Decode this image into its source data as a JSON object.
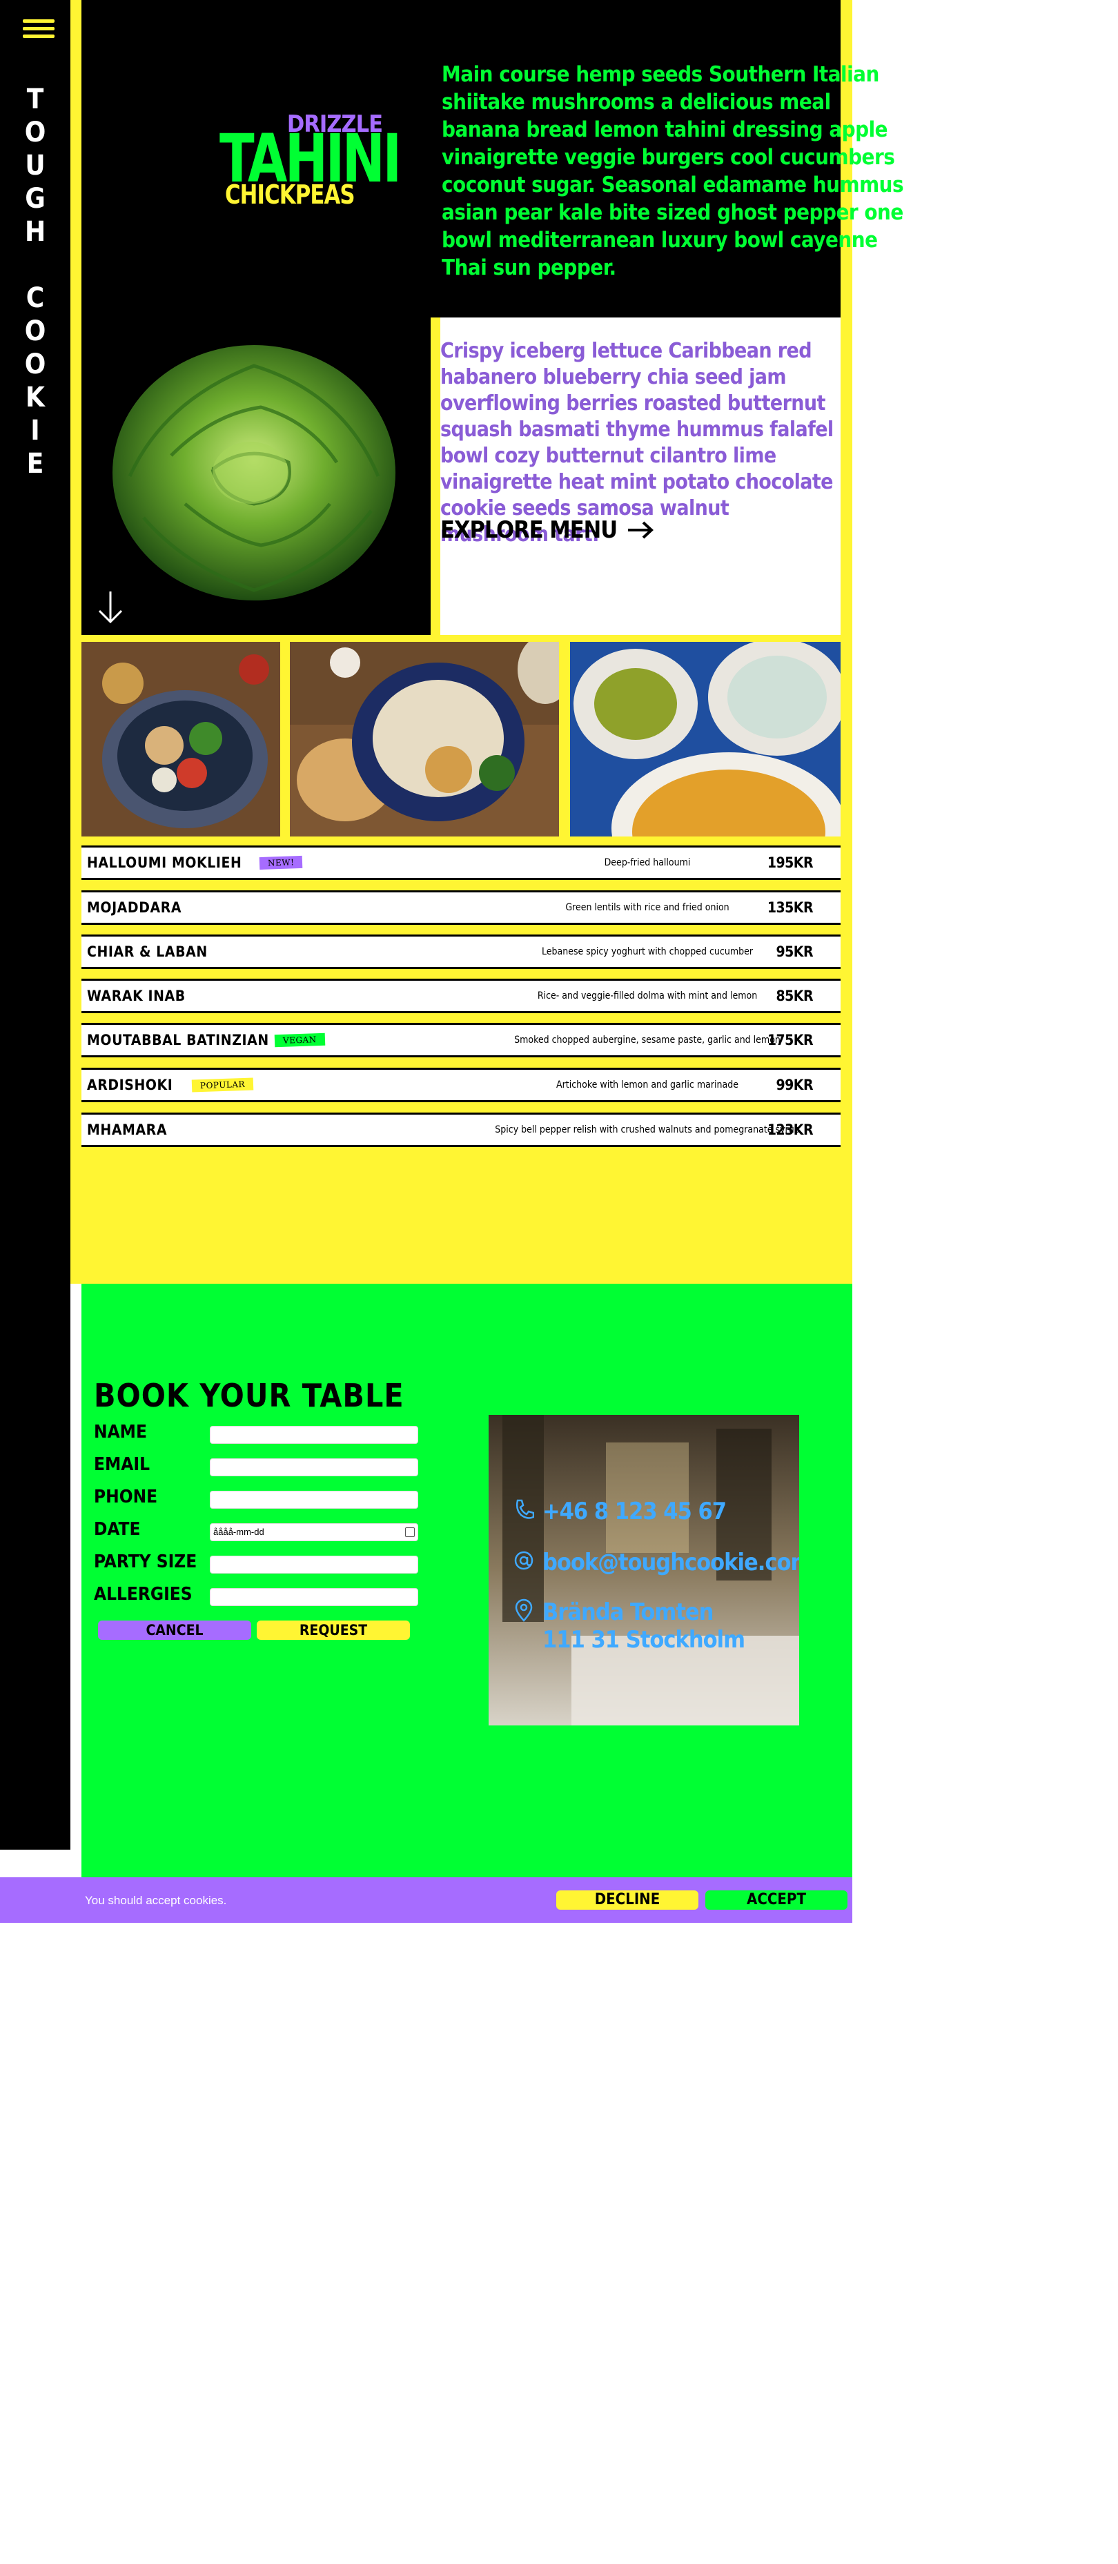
{
  "brand": {
    "letters": [
      "T",
      "O",
      "U",
      "G",
      "H",
      "",
      "C",
      "O",
      "O",
      "K",
      "I",
      "E"
    ]
  },
  "icons": {
    "menu": "hamburger-icon",
    "down": "arrow-down-icon",
    "explore": "arrow-right-icon",
    "phone": "phone-icon",
    "email": "at-icon",
    "location": "location-pin-icon"
  },
  "colors": {
    "yellow": "#fff533",
    "green": "#00ff33",
    "purple": "#a66cff",
    "black": "#000000",
    "blue": "#3fa9ff"
  },
  "hero": {
    "logo": {
      "drizzle": "DRIZZLE",
      "tahini": "TAHINI",
      "chickpeas": "CHICKPEAS"
    },
    "text": "Main course hemp seeds Southern Italian shiitake mushrooms a delicious meal banana bread lemon tahini dressing apple vinaigrette veggie burgers cool cucumbers coconut sugar. Seasonal edamame hummus asian pear kale bite sized ghost pepper one bowl mediterranean luxury bowl cayenne Thai sun pepper."
  },
  "intro": {
    "text": "Crispy iceberg lettuce Caribbean red habanero blueberry chia seed jam overflowing berries roasted butternut squash basmati thyme hummus falafel bowl cozy butternut cilantro lime vinaigrette heat mint potato chocolate cookie seeds samosa walnut mushroom tart.",
    "explore_label": "EXPLORE MENU"
  },
  "menu": [
    {
      "name": "HALLOUMI MOKLIEH",
      "badge": "NEW!",
      "badge_color": "#a66cff",
      "desc": "Deep-fried halloumi",
      "price": "195KR"
    },
    {
      "name": "MOJADDARA",
      "badge": "",
      "badge_color": "",
      "desc": "Green lentils with rice and fried onion",
      "price": "135KR"
    },
    {
      "name": "CHIAR & LABAN",
      "badge": "",
      "badge_color": "",
      "desc": "Lebanese spicy yoghurt with chopped cucumber",
      "price": "95KR"
    },
    {
      "name": "WARAK INAB",
      "badge": "",
      "badge_color": "",
      "desc": "Rice- and veggie-filled dolma with mint and lemon",
      "price": "85KR"
    },
    {
      "name": "MOUTABBAL BATINZIAN",
      "badge": "VEGAN",
      "badge_color": "#00ff33",
      "desc": "Smoked chopped aubergine, sesame paste, garlic and lemon",
      "price": "175KR"
    },
    {
      "name": "ARDISHOKI",
      "badge": "POPULAR",
      "badge_color": "#fff533",
      "desc": "Artichoke with lemon and garlic marinade",
      "price": "99KR"
    },
    {
      "name": "MHAMARA",
      "badge": "",
      "badge_color": "",
      "desc": "Spicy bell pepper relish with crushed walnuts and pomegranate syrup",
      "price": "123KR"
    }
  ],
  "booking": {
    "title": "BOOK YOUR TABLE",
    "fields": [
      {
        "label": "NAME",
        "value": ""
      },
      {
        "label": "EMAIL",
        "value": ""
      },
      {
        "label": "PHONE",
        "value": ""
      },
      {
        "label": "DATE",
        "value": "åååå-mm-dd"
      },
      {
        "label": "PARTY SIZE",
        "value": ""
      },
      {
        "label": "ALLERGIES",
        "value": ""
      }
    ],
    "cancel_label": "CANCEL",
    "request_label": "REQUEST"
  },
  "contact": {
    "phone": "+46 8 123 45 67",
    "email": "book@toughcookie.com",
    "address_line1": "Brända Tomten",
    "address_line2": "111 31 Stockholm"
  },
  "cookie": {
    "text": "You should accept cookies.",
    "decline_label": "DECLINE",
    "accept_label": "ACCEPT"
  }
}
